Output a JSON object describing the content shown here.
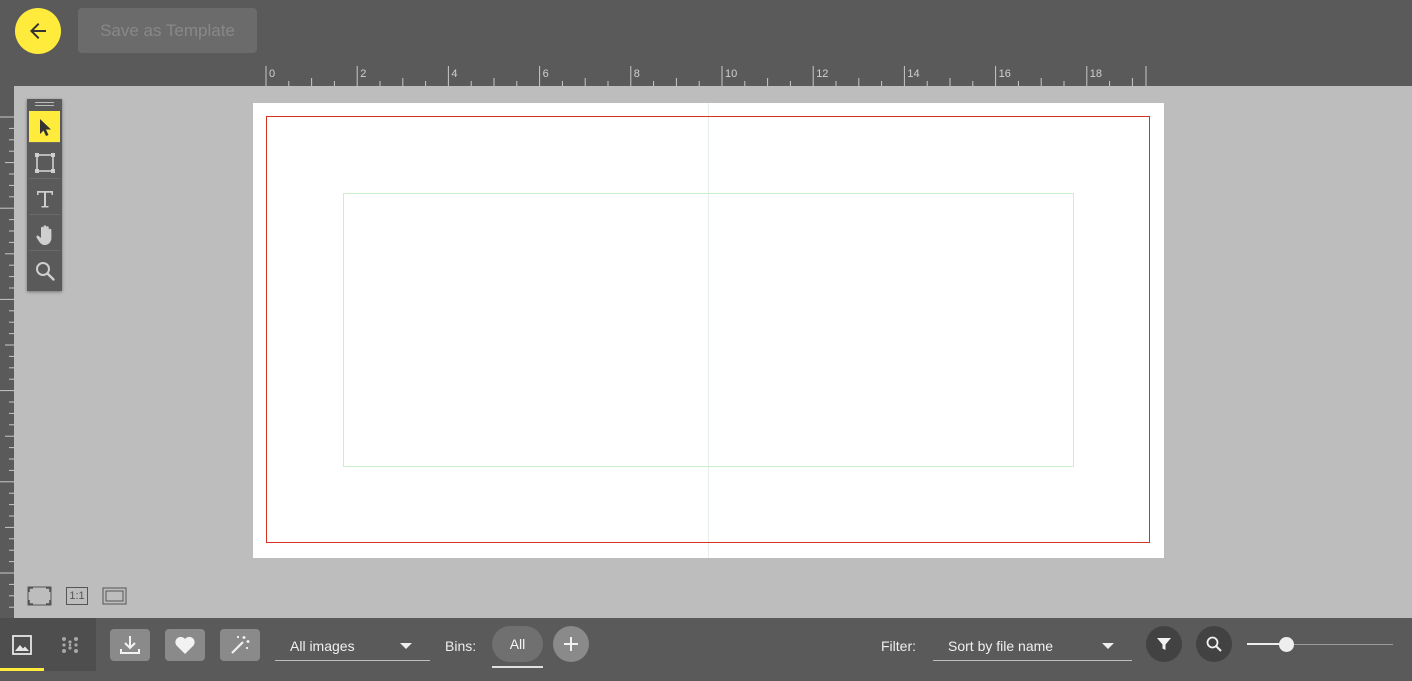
{
  "app": {
    "save_template_label": "Save as Template",
    "back_icon": "arrow-left-icon",
    "accent_color": "#ffeb3b"
  },
  "ruler": {
    "horizontal_labels": [
      "0",
      "2",
      "4",
      "6",
      "8",
      "10",
      "12",
      "14",
      "16",
      "18"
    ]
  },
  "canvas": {
    "bleed_color": "#d4321f",
    "safe_area_color": "#c9f0c9"
  },
  "tools": [
    {
      "name": "select",
      "icon": "cursor-arrow-icon",
      "active": true
    },
    {
      "name": "frame",
      "icon": "frame-icon",
      "active": false
    },
    {
      "name": "text",
      "icon": "text-icon",
      "active": false
    },
    {
      "name": "pan",
      "icon": "hand-icon",
      "active": false
    },
    {
      "name": "zoom",
      "icon": "magnifier-icon",
      "active": false
    }
  ],
  "view_controls": {
    "actual_size_label": "1:1"
  },
  "bottom": {
    "source_select": "All images",
    "bins_label": "Bins:",
    "bins_all": "All",
    "filter_label": "Filter:",
    "sort_select": "Sort by file name",
    "zoom_slider_fraction": 0.27
  }
}
